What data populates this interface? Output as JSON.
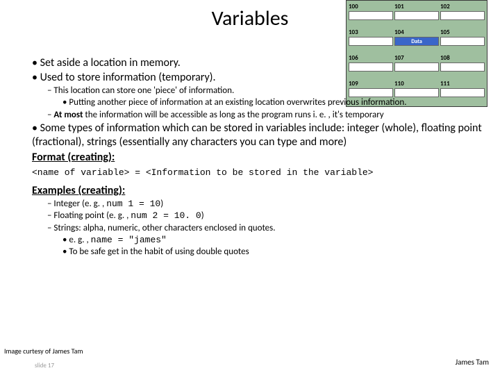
{
  "title": "Variables",
  "bullets": {
    "b1": "Set aside a location in memory.",
    "b2": "Used to store information (temporary).",
    "b2_1": "This location can store one 'piece' of information.",
    "b2_1_1": "Putting another piece of information at an existing location overwrites previous information.",
    "b2_2_prefix": "At most",
    "b2_2_rest": " the information will be accessible as long as the program runs i. e. , it's temporary",
    "b3": "Some types of information which can be stored in variables include: integer (whole), floating point (fractional), strings (essentially any characters you can type and more)",
    "format_label": "Format (creating):",
    "code": "<name of variable> = <Information to be stored in the variable>",
    "examples_label": "Examples (creating):",
    "ex1_pre": "Integer (e. g. , ",
    "ex1_code": "num 1 = 10",
    "ex1_post": ")",
    "ex2_pre": "Floating point (e. g. , ",
    "ex2_code": "num 2 = 10. 0",
    "ex2_post": ")",
    "ex3": "Strings: alpha, numeric, other characters enclosed in quotes.",
    "ex3_1_pre": "e. g. , ",
    "ex3_1_code": "name = \"james\"",
    "ex3_2": "To be safe get in the habit of using double quotes"
  },
  "memory": {
    "cells": [
      "100",
      "101",
      "102",
      "103",
      "104",
      "105",
      "106",
      "107",
      "108",
      "109",
      "110",
      "111"
    ],
    "data_label": "Data",
    "data_index": 4
  },
  "footer": {
    "credit": "Image curtesy of James Tam",
    "slide": "slide 17",
    "author": "James Tam"
  }
}
